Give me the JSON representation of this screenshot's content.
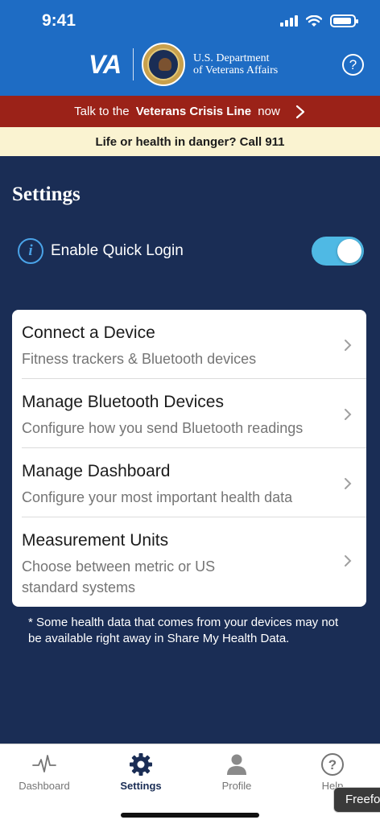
{
  "status_bar": {
    "time": "9:41"
  },
  "header": {
    "logo_text": "VA",
    "dept_line1": "U.S. Department",
    "dept_line2": "of Veterans Affairs",
    "help_label": "?"
  },
  "crisis_banner": {
    "prefix": "Talk to the ",
    "bold": "Veterans Crisis Line",
    "suffix": " now"
  },
  "danger_banner": {
    "text": "Life or health in danger? Call 911"
  },
  "settings": {
    "title": "Settings",
    "quick_login": {
      "label": "Enable Quick Login",
      "enabled": true
    },
    "items": [
      {
        "title": "Connect a Device",
        "subtitle": "Fitness trackers & Bluetooth devices"
      },
      {
        "title": "Manage Bluetooth Devices",
        "subtitle": "Configure how you send Bluetooth readings"
      },
      {
        "title": "Manage Dashboard",
        "subtitle": "Configure your most important health data"
      },
      {
        "title": "Measurement Units",
        "subtitle": "Choose between metric or US standard systems"
      }
    ],
    "footnote": "* Some health data that comes from your devices may not be available right away in Share My Health Data."
  },
  "tabbar": {
    "tabs": [
      {
        "label": "Dashboard",
        "icon": "pulse-icon",
        "active": false
      },
      {
        "label": "Settings",
        "icon": "gear-icon",
        "active": true
      },
      {
        "label": "Profile",
        "icon": "person-icon",
        "active": false
      },
      {
        "label": "Help",
        "icon": "question-icon",
        "active": false
      }
    ]
  },
  "overlay": {
    "freeform_label": "Freeform"
  },
  "colors": {
    "header_blue": "#1e6cc4",
    "crisis_red": "#9b2218",
    "danger_yellow": "#faf3d1",
    "navy": "#1a2d55",
    "toggle_on": "#4fb9e4"
  }
}
